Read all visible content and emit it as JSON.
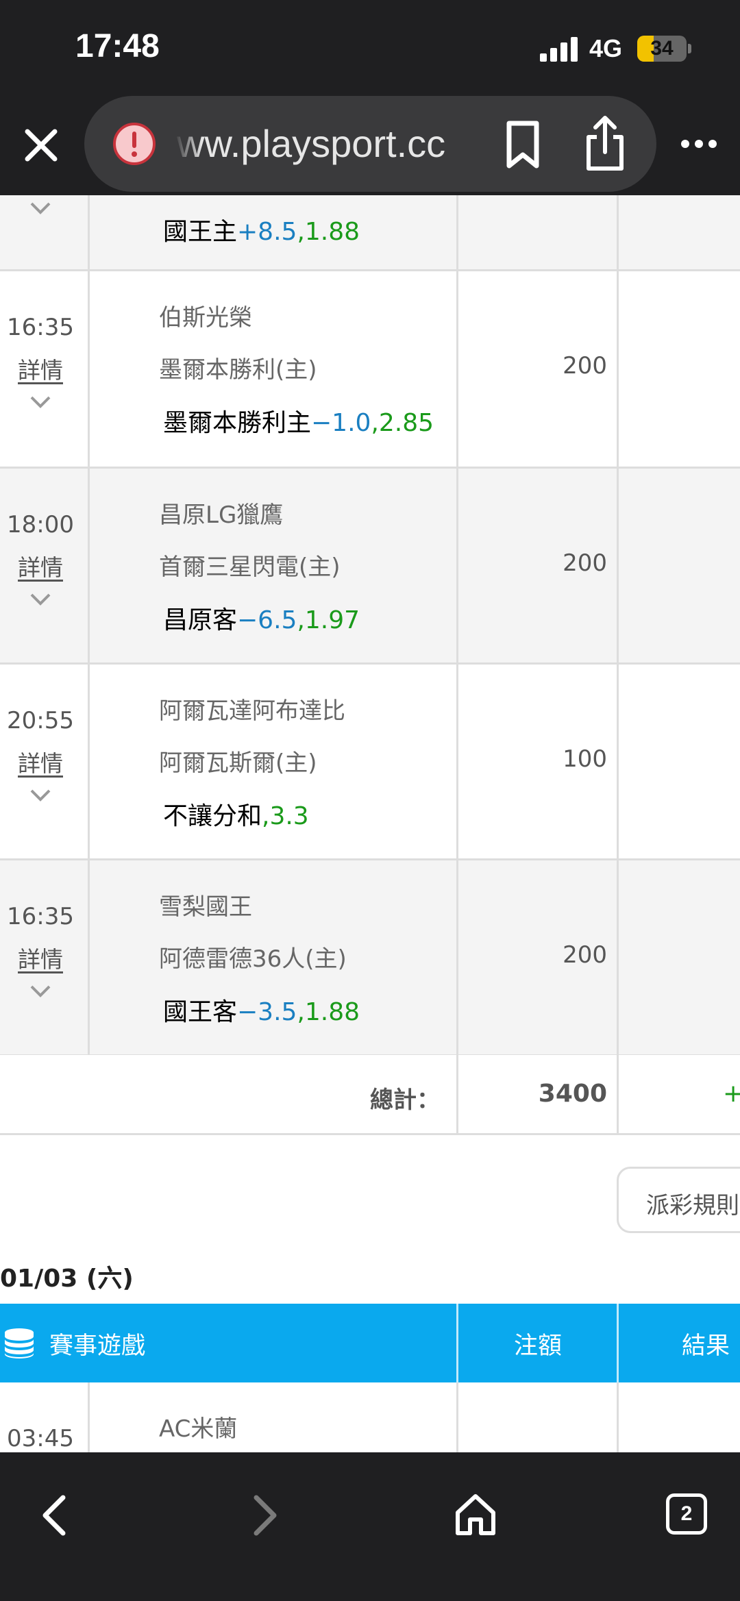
{
  "status_bar": {
    "time": "17:48",
    "network": "4G",
    "battery_level": "34",
    "battery_fraction": 0.34
  },
  "browser": {
    "url": "ww.playsport.cc",
    "tab_count": "2"
  },
  "games": [
    {
      "time": "",
      "detail_label": "",
      "team_away": "",
      "team_home": "",
      "pick_name": "國王主",
      "pick_line": "+8.5",
      "pick_odds": ",1.88",
      "amount": ""
    },
    {
      "time": "16:35",
      "detail_label": "詳情",
      "team_away": "伯斯光榮",
      "team_home": "墨爾本勝利(主)",
      "pick_name": "墨爾本勝利主",
      "pick_line": "−1.0",
      "pick_odds": ",2.85",
      "amount": "200"
    },
    {
      "time": "18:00",
      "detail_label": "詳情",
      "team_away": "昌原LG獵鷹",
      "team_home": "首爾三星閃電(主)",
      "pick_name": "昌原客",
      "pick_line": "−6.5",
      "pick_odds": ",1.97",
      "amount": "200"
    },
    {
      "time": "20:55",
      "detail_label": "詳情",
      "team_away": "阿爾瓦達阿布達比",
      "team_home": "阿爾瓦斯爾(主)",
      "pick_name": "不讓分和",
      "pick_line": "",
      "pick_odds": ",3.3",
      "amount": "100"
    },
    {
      "time": "16:35",
      "detail_label": "詳情",
      "team_away": "雪梨國王",
      "team_home": "阿德雷德36人(主)",
      "pick_name": "國王客",
      "pick_line": "−3.5",
      "pick_odds": ",1.88",
      "amount": "200"
    }
  ],
  "total": {
    "label": "總計：",
    "value": "3400",
    "result": "+"
  },
  "rules_button": "派彩規則",
  "next_date": "01/03 (六)",
  "table_header": {
    "game": "賽事遊戲",
    "amount": "注額",
    "result": "結果"
  },
  "next_game": {
    "time": "03:45",
    "team_away": "AC米蘭"
  },
  "colors": {
    "accent": "#0aa9ee",
    "line_blue": "#1a7fc1",
    "odds_green": "#1a9a1a",
    "chrome": "#1f1f21"
  },
  "icons": [
    "close-icon",
    "alert-icon",
    "bookmark-icon",
    "share-icon",
    "more-icon",
    "chevron-down-icon",
    "coin-stack-icon",
    "back-icon",
    "forward-icon",
    "home-icon",
    "tabs-icon"
  ]
}
